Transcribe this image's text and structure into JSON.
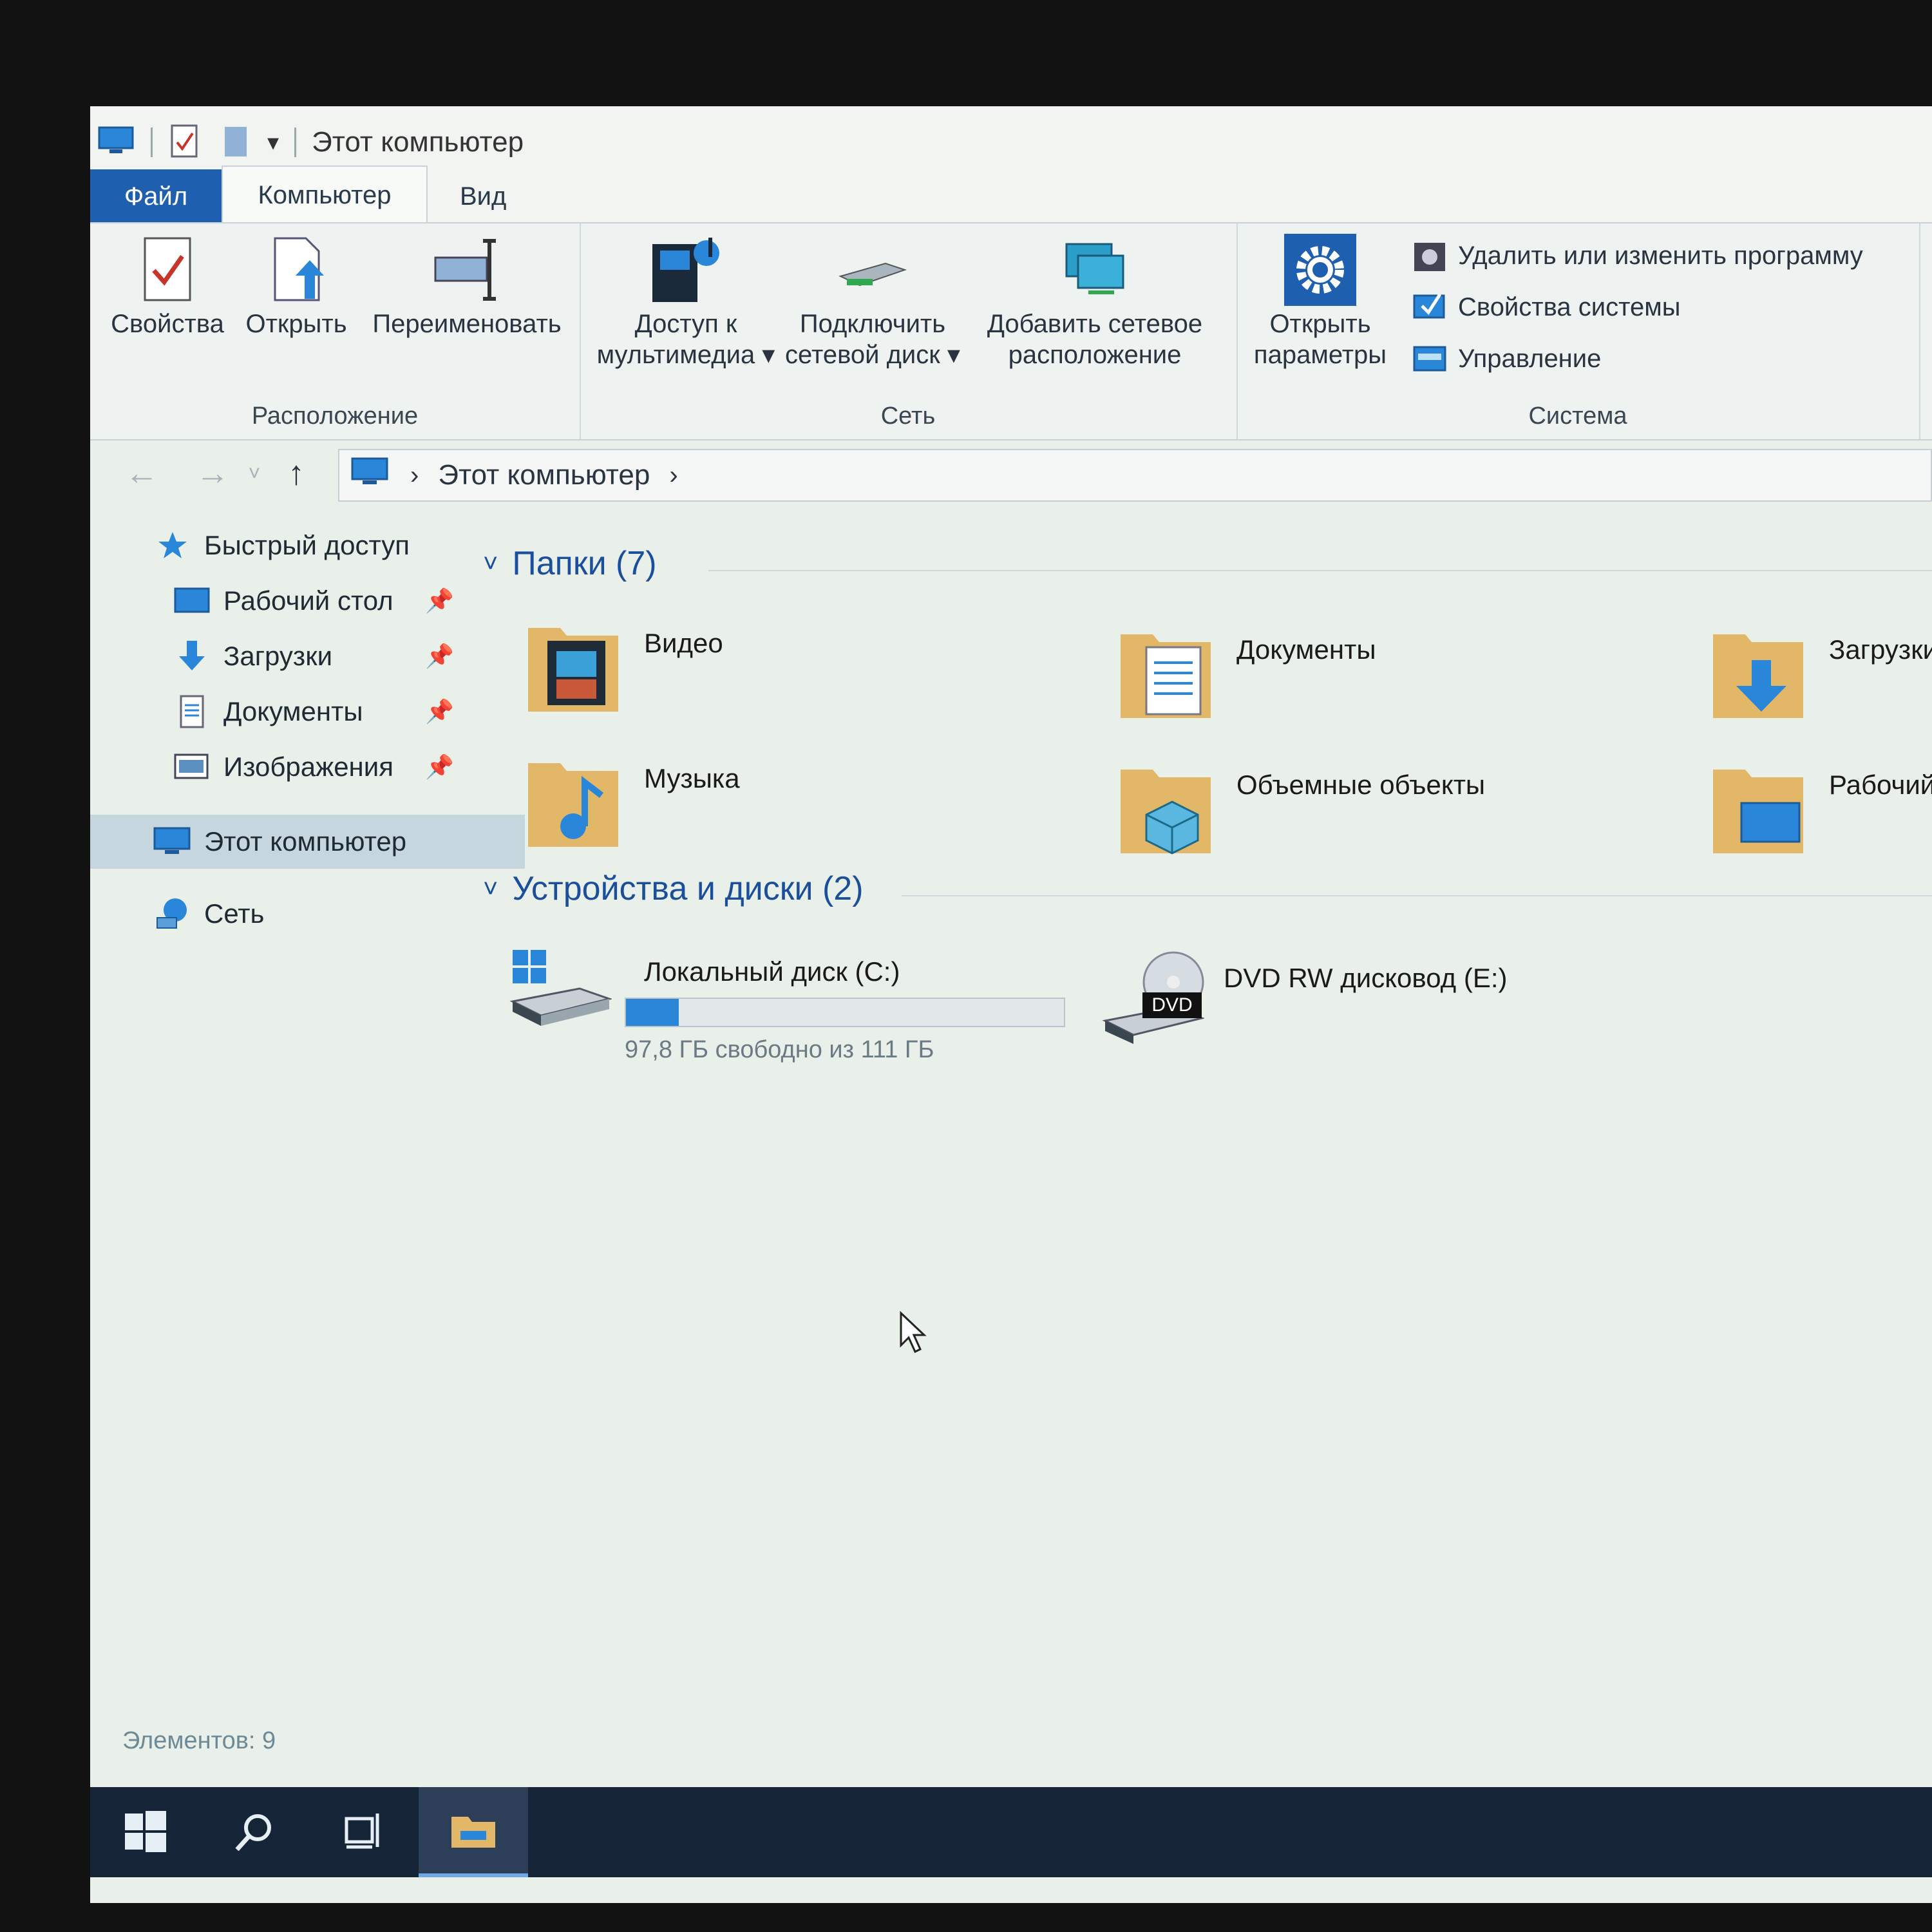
{
  "window": {
    "title": "Этот компьютер"
  },
  "ribbon_tabs": [
    {
      "label": "Файл"
    },
    {
      "label": "Компьютер"
    },
    {
      "label": "Вид"
    }
  ],
  "ribbon": {
    "location": {
      "label": "Расположение",
      "properties": "Свойства",
      "open": "Открыть",
      "rename": "Переименовать"
    },
    "network": {
      "label": "Сеть",
      "media_access": "Доступ к\nмультимедиа ▾",
      "map_drive": "Подключить\nсетевой диск ▾",
      "add_location": "Добавить сетевое\nрасположение"
    },
    "system": {
      "label": "Система",
      "open_settings": "Открыть\nпараметры",
      "uninstall": "Удалить или изменить программу",
      "system_properties": "Свойства системы",
      "manage": "Управление"
    }
  },
  "address": {
    "path": "Этот компьютер",
    "back_icon": "arrow-left-icon",
    "forward_icon": "arrow-right-icon",
    "up_icon": "arrow-up-icon"
  },
  "nav": {
    "quick_access": "Быстрый доступ",
    "items": [
      {
        "label": "Рабочий стол",
        "icon": "desktop-icon"
      },
      {
        "label": "Загрузки",
        "icon": "downloads-icon"
      },
      {
        "label": "Документы",
        "icon": "documents-icon"
      },
      {
        "label": "Изображения",
        "icon": "pictures-icon"
      }
    ],
    "this_pc": "Этот компьютер",
    "network": "Сеть"
  },
  "folders_section": {
    "title": "Папки (7)",
    "items": [
      {
        "name": "Видео",
        "icon": "video-folder-icon"
      },
      {
        "name": "Документы",
        "icon": "documents-folder-icon"
      },
      {
        "name": "Загрузки",
        "icon": "downloads-folder-icon"
      },
      {
        "name": "Музыка",
        "icon": "music-folder-icon"
      },
      {
        "name": "Объемные объекты",
        "icon": "3d-objects-folder-icon"
      },
      {
        "name": "Рабочий стол",
        "icon": "desktop-folder-icon"
      }
    ]
  },
  "devices_section": {
    "title": "Устройства и диски (2)",
    "drives": [
      {
        "name": "Локальный диск (C:)",
        "free": "97,8 ГБ свободно из 111 ГБ",
        "used_fraction": 0.12
      },
      {
        "name": "DVD RW дисковод (E:)",
        "badge": "DVD"
      }
    ]
  },
  "status": {
    "text": "Элементов: 9"
  },
  "colors": {
    "accent": "#1f5fb0",
    "selection": "#c6d6df",
    "taskbar": "#152437",
    "capacity_fill": "#2a86d8"
  }
}
